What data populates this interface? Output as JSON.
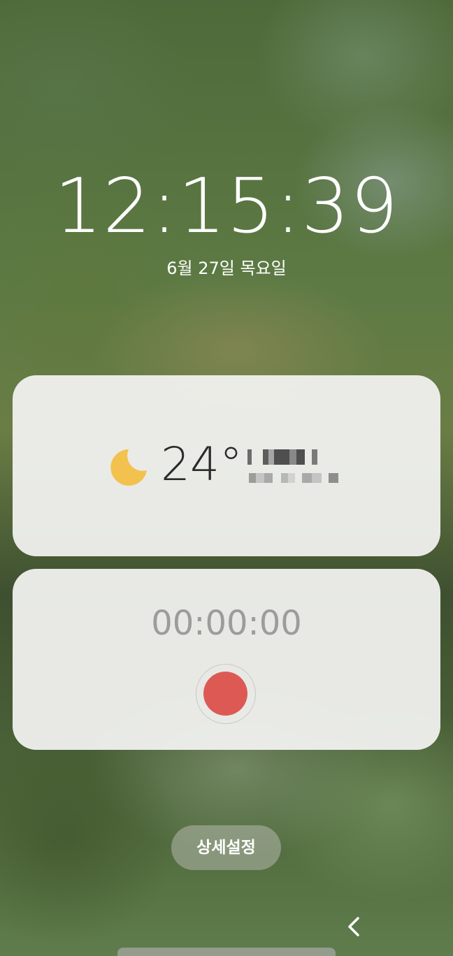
{
  "lockscreen": {
    "time": "12:15:39",
    "date": "6월 27일 목요일"
  },
  "weather": {
    "icon": "moon-icon",
    "temperature": "24°",
    "location_redacted": true,
    "moon_color": "#f3c24e"
  },
  "recorder": {
    "elapsed": "00:00:00",
    "record_button_color": "#dd5a54"
  },
  "settings_button": {
    "label": "상세설정"
  },
  "navigation": {
    "back_icon": "chevron-left-icon"
  }
}
